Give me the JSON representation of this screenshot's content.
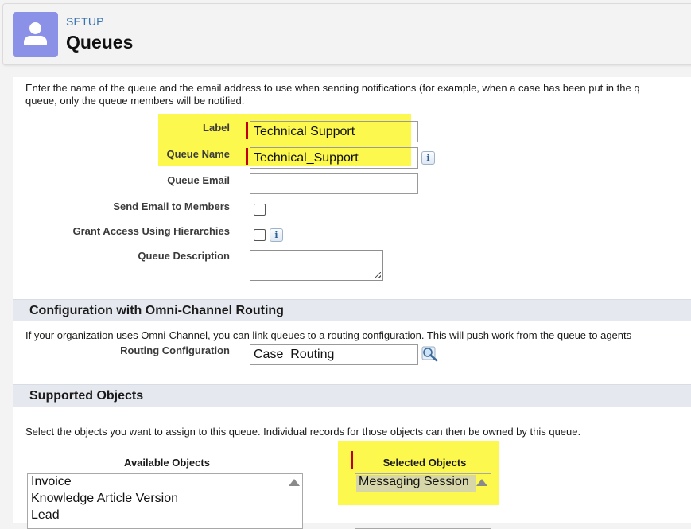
{
  "header": {
    "setup_label": "SETUP",
    "title": "Queues",
    "icon": "user-icon"
  },
  "intro_text_line1": "Enter the name of the queue and the email address to use when sending notifications (for example, when a case has been put in the q",
  "intro_text_line2": "queue, only the queue members will be notified.",
  "form": {
    "label_label": "Label",
    "label_value": "Technical Support",
    "queue_name_label": "Queue Name",
    "queue_name_value": "Technical_Support",
    "queue_email_label": "Queue Email",
    "queue_email_value": "",
    "send_email_label": "Send Email to Members",
    "send_email_checked": false,
    "grant_access_label": "Grant Access Using Hierarchies",
    "grant_access_checked": false,
    "description_label": "Queue Description",
    "description_value": "",
    "info_glyph": "i"
  },
  "omni": {
    "section_title": "Configuration with Omni-Channel Routing",
    "description": "If your organization uses Omni-Channel, you can link queues to a routing configuration. This will push work from the queue to agents",
    "routing_label": "Routing Configuration",
    "routing_value": "Case_Routing",
    "lookup_icon": "lookup-magnifier-icon"
  },
  "supported": {
    "section_title": "Supported Objects",
    "description": "Select the objects you want to assign to this queue. Individual records for those objects can then be owned by this queue.",
    "available_header": "Available Objects",
    "available_items": [
      "Invoice",
      "Knowledge Article Version",
      "Lead"
    ],
    "selected_header": "Selected Objects",
    "selected_items": [
      "Messaging Session"
    ]
  },
  "colors": {
    "highlight": "#fdf84d",
    "required": "#c00000",
    "header_icon_bg": "#8c91e8",
    "section_bg": "#e5e9ef"
  }
}
